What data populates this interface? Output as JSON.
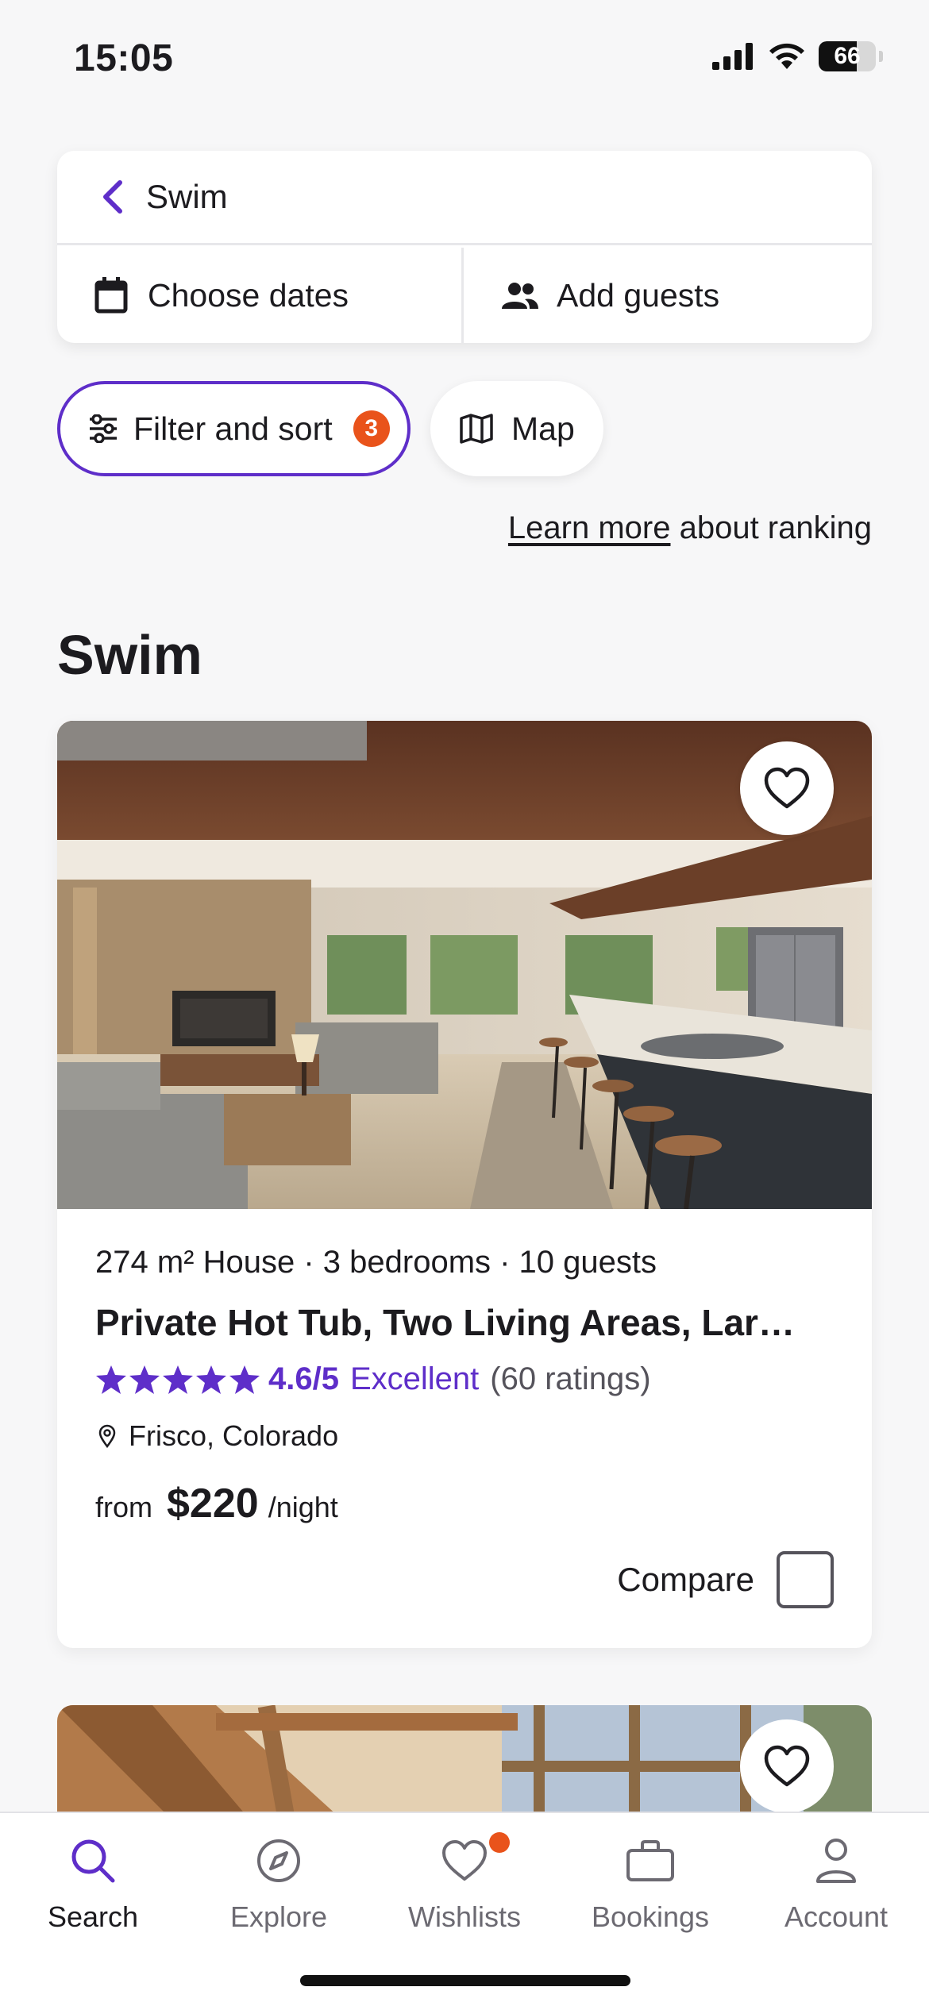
{
  "status_bar": {
    "time": "15:05",
    "battery": "66",
    "battery_level": 0.66
  },
  "search": {
    "query": "Swim",
    "dates_label": "Choose dates",
    "guests_label": "Add guests"
  },
  "filters": {
    "filter_label": "Filter and sort",
    "filter_count": "3",
    "map_label": "Map"
  },
  "ranking": {
    "link": "Learn more",
    "text": " about ranking"
  },
  "section_title": "Swim",
  "listing": {
    "meta": "274 m² House · 3 bedrooms · 10 guests",
    "title": "Private Hot Tub, Two Living Areas, Large Kitchen",
    "rating_score": "4.6/5",
    "rating_word": "Excellent",
    "rating_count": "(60 ratings)",
    "stars": 5,
    "location": "Frisco, Colorado",
    "price_from": "from",
    "price": "$220",
    "price_unit": "/night",
    "compare_label": "Compare"
  },
  "tabs": [
    {
      "label": "Search",
      "icon": "search-icon",
      "active": true
    },
    {
      "label": "Explore",
      "icon": "compass-icon",
      "active": false
    },
    {
      "label": "Wishlists",
      "icon": "heart-icon",
      "active": false
    },
    {
      "label": "Bookings",
      "icon": "briefcase-icon",
      "active": false
    },
    {
      "label": "Account",
      "icon": "person-icon",
      "active": false
    }
  ],
  "colors": {
    "accent": "#5e2ec9",
    "badge": "#e9531b"
  }
}
